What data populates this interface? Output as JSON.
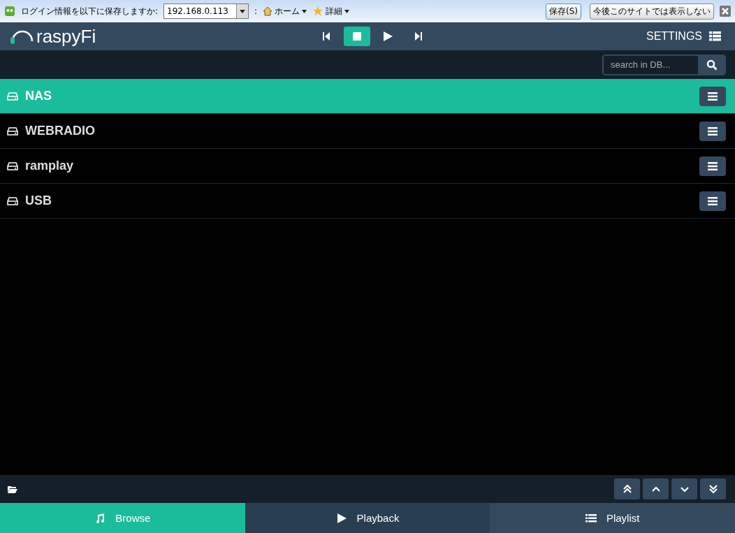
{
  "browser_bar": {
    "prompt": "ログイン情報を以下に保存しますか:",
    "site": "192.168.0.113",
    "separator": ":",
    "links": [
      {
        "label": "ホーム",
        "kind": "home"
      },
      {
        "label": "詳細",
        "kind": "star"
      }
    ],
    "buttons": [
      "保存(S)",
      "今後このサイトでは表示しない"
    ]
  },
  "header": {
    "logo": "raspyFi",
    "transport": [
      {
        "kind": "prev",
        "selected": false
      },
      {
        "kind": "stop",
        "selected": true
      },
      {
        "kind": "play",
        "selected": false
      },
      {
        "kind": "next",
        "selected": false
      }
    ],
    "settings": "SETTINGS"
  },
  "search": {
    "placeholder": "search in DB..."
  },
  "sources": [
    {
      "name": "NAS",
      "selected": true
    },
    {
      "name": "WEBRADIO",
      "selected": false
    },
    {
      "name": "ramplay",
      "selected": false
    },
    {
      "name": "USB",
      "selected": false
    }
  ],
  "scroll_buttons": [
    {
      "kind": "top"
    },
    {
      "kind": "up"
    },
    {
      "kind": "down"
    },
    {
      "kind": "bottom"
    }
  ],
  "tabs": [
    {
      "label": "Browse",
      "kind": "music",
      "selected": true
    },
    {
      "label": "Playback",
      "kind": "play",
      "selected": false
    },
    {
      "label": "Playlist",
      "kind": "list",
      "selected": false
    }
  ]
}
